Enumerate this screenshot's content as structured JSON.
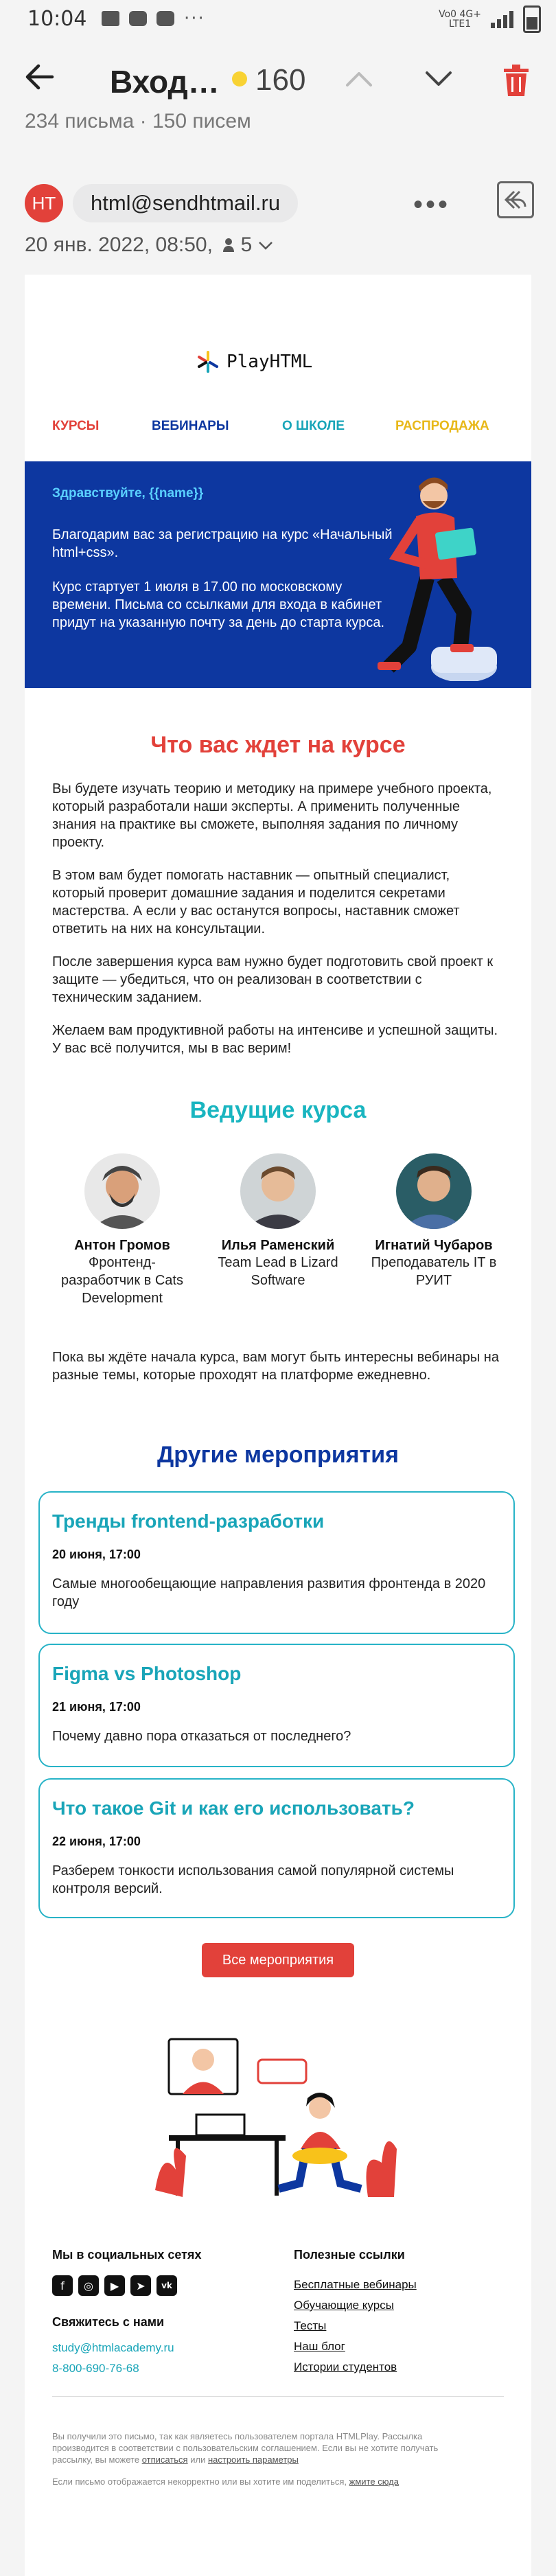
{
  "status_bar": {
    "time": "10:04",
    "dots": "···",
    "network_top": "Vo0 4G+",
    "network_bottom": "LTE1"
  },
  "toolbar": {
    "title": "Вход…",
    "unread_count": "160",
    "colors": {
      "dot": "#f8d233",
      "trash": "#e2413a"
    }
  },
  "preview_line": "234 письма  ·  150 писем",
  "message": {
    "avatar_initials": "HT",
    "sender_email": "html@sendhtmail.ru",
    "date": "20 янв. 2022, 08:50,",
    "recipients_count": "5"
  },
  "email": {
    "logo_text": "PlayHTML",
    "nav": [
      {
        "label": "КУРСЫ",
        "color": "#e2413a"
      },
      {
        "label": "ВЕБИНАРЫ",
        "color": "#0d37a0"
      },
      {
        "label": "О ШКОЛЕ",
        "color": "#19a5b8"
      },
      {
        "label": "РАСПРОДАЖА",
        "color": "#e8b81a"
      }
    ],
    "hero": {
      "greeting": "Здравствуйте, {{name}}",
      "p1": "Благодарим вас за регистрацию на курс «Начальный html+css».",
      "p2": "Курс стартует 1 июля в 17.00 по московскому времени. Письма со ссылками для входа в кабинет придут на указанную почту за день до старта курса."
    },
    "section1": {
      "title": "Что вас ждет на курсе",
      "paragraphs": [
        "Вы будете изучать теорию и методику на примере учебного проекта, который разработали наши эксперты. А применить полученные знания на практике вы сможете, выполняя задания по личному проекту.",
        "В этом вам будет помогать наставник — опытный специалист, который проверит домашние задания и поделится секретами мастерства. А если у вас останутся вопросы, наставник сможет ответить на них на консультации.",
        "После завершения курса вам нужно будет подготовить свой проект к защите — убедиться, что он реализован в соответствии с техническим заданием.",
        "Желаем вам продуктивной работы на интенсиве и успешной защиты. У вас всё получится, мы в вас верим!"
      ]
    },
    "teachers_title": "Ведущие курса",
    "teachers": [
      {
        "name": "Антон Громов",
        "role": "Фронтенд-разработчик в Cats Development"
      },
      {
        "name": "Илья Раменский",
        "role": "Team Lead в Lizard Software"
      },
      {
        "name": "Игнатий Чубаров",
        "role": "Преподаватель IT в РУИТ"
      }
    ],
    "webinars_intro": "Пока вы ждёте начала курса, вам могут быть интересны вебинары на разные темы, которые проходят на платформе ежедневно.",
    "events_title": "Другие мероприятия",
    "events": [
      {
        "title": "Тренды frontend-разработки",
        "date": "20 июня, 17:00",
        "desc": "Самые многообещающие направления развития фронтенда в 2020 году"
      },
      {
        "title": "Figma vs Photoshop",
        "date": "21 июня, 17:00",
        "desc": "Почему давно пора отказаться от последнего?"
      },
      {
        "title": "Что такое Git и как его использовать?",
        "date": "22 июня, 17:00",
        "desc": "Разберем тонкости использования самой популярной системы контроля версий."
      }
    ],
    "all_events_button": "Все мероприятия",
    "footer": {
      "social_title": "Мы в социальных сетях",
      "social_icons": [
        "facebook-icon",
        "instagram-icon",
        "youtube-icon",
        "telegram-icon",
        "vk-icon"
      ],
      "contact_title": "Свяжитесь с нами",
      "email": "study@htmlacademy.ru",
      "phone": "8-800-690-76-68",
      "links_title": "Полезные ссылки",
      "links": [
        "Бесплатные вебинары",
        "Обучающие курсы",
        "Тесты",
        "Наш блог",
        "Истории студентов"
      ],
      "legal1_a": "Вы получили это письмо, так как являетесь пользователем портала HTMLPlay. Рассылка производится в соответствии с пользовательским соглашением. Если вы не хотите получать рассылку, вы можете ",
      "legal1_link1": "отписаться",
      "legal1_b": " или ",
      "legal1_link2": "настроить параметры",
      "legal2_a": "Если письмо отображается некорректно или вы хотите им поделиться, ",
      "legal2_link": "жмите сюда"
    }
  }
}
